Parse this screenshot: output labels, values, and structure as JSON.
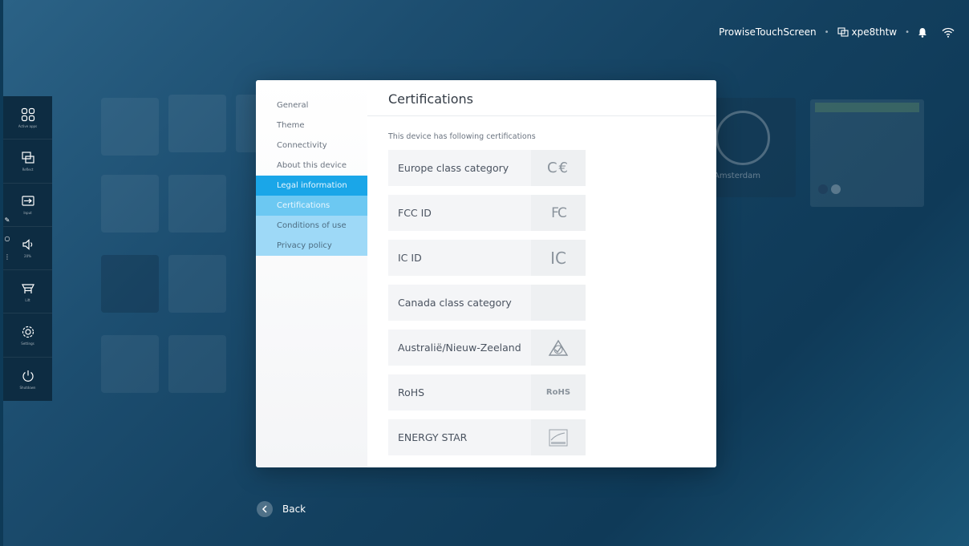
{
  "statusbar": {
    "device_name": "ProwiseTouchScreen",
    "network_name": "xpe8thtw",
    "icons": [
      "network-icon",
      "bell-icon",
      "wifi-icon"
    ]
  },
  "dock": {
    "items": [
      {
        "label": "Active apps",
        "icon": "apps-icon"
      },
      {
        "label": "Reflect",
        "icon": "reflect-icon"
      },
      {
        "label": "Input",
        "icon": "input-icon"
      },
      {
        "label": "20%",
        "icon": "volume-icon"
      },
      {
        "label": "Lift",
        "icon": "lift-icon"
      },
      {
        "label": "Settings",
        "icon": "gear-icon"
      },
      {
        "label": "Shutdown",
        "icon": "power-icon"
      }
    ]
  },
  "background": {
    "clock_city": "Amsterdam"
  },
  "settings": {
    "nav": [
      {
        "label": "General",
        "state": "normal"
      },
      {
        "label": "Theme",
        "state": "normal"
      },
      {
        "label": "Connectivity",
        "state": "normal"
      },
      {
        "label": "About this device",
        "state": "normal"
      },
      {
        "label": "Legal information",
        "state": "active-parent"
      },
      {
        "label": "Certifications",
        "state": "active"
      },
      {
        "label": "Conditions of use",
        "state": "sub"
      },
      {
        "label": "Privacy policy",
        "state": "sub"
      }
    ],
    "title": "Certifications",
    "description": "This device has following certifications",
    "certifications": [
      {
        "name": "Europe class category",
        "logo": "ce-logo",
        "logo_text": "C€"
      },
      {
        "name": "FCC ID",
        "logo": "fcc-logo",
        "logo_text": "FC"
      },
      {
        "name": "IC ID",
        "logo": "ic-logo",
        "logo_text": "IC"
      },
      {
        "name": "Canada class category",
        "logo": "none",
        "logo_text": ""
      },
      {
        "name": "Australië/Nieuw-Zeeland",
        "logo": "rcm-logo",
        "logo_text": ""
      },
      {
        "name": "RoHS",
        "logo": "rohs-logo",
        "logo_text": "RoHS"
      },
      {
        "name": "ENERGY STAR",
        "logo": "energy-star-logo",
        "logo_text": ""
      }
    ]
  },
  "back": {
    "label": "Back"
  },
  "colors": {
    "nav_active_parent": "#1aa6e8",
    "nav_active": "#6cc8f2",
    "nav_sub": "#9ed9f7",
    "dock_bg": "#0d2c42"
  }
}
